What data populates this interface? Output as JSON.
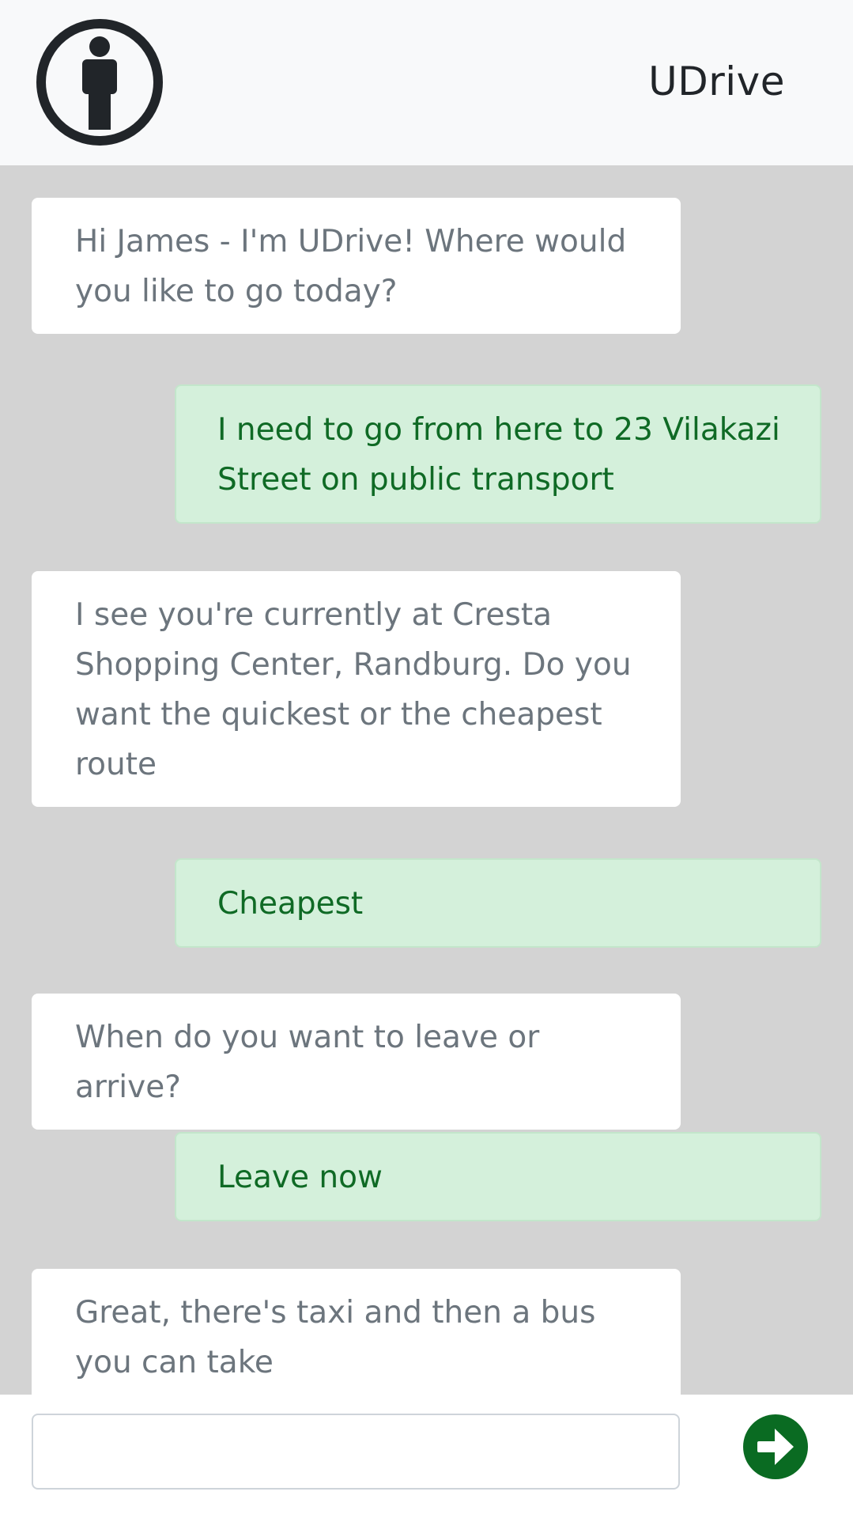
{
  "header": {
    "title": "UDrive",
    "logo_icon": "info-person-icon"
  },
  "messages": [
    {
      "sender": "bot",
      "text": "Hi James - I'm UDrive! Where would you like to go today?"
    },
    {
      "sender": "user",
      "text": "I need to go from here to 23 Vilakazi Street on public transport"
    },
    {
      "sender": "bot",
      "text": "I see you're currently at Cresta Shopping Center, Randburg. Do you want the quickest or the cheapest route"
    },
    {
      "sender": "user",
      "text": "Cheapest"
    },
    {
      "sender": "bot",
      "text": "When do you want to leave or arrive?"
    },
    {
      "sender": "user",
      "text": "Leave now"
    },
    {
      "sender": "bot",
      "text": "Great, there's taxi and then a bus you can take"
    }
  ],
  "composer": {
    "value": "",
    "placeholder": "",
    "send_icon": "arrow-right-circle-icon"
  },
  "colors": {
    "header_bg": "#f8f9fa",
    "chat_bg": "#d3d3d3",
    "bot_bubble": "#ffffff",
    "bot_text": "#6c757d",
    "user_bubble": "#d4f0db",
    "user_text": "#0f6a25",
    "send_button": "#0a6b22"
  }
}
